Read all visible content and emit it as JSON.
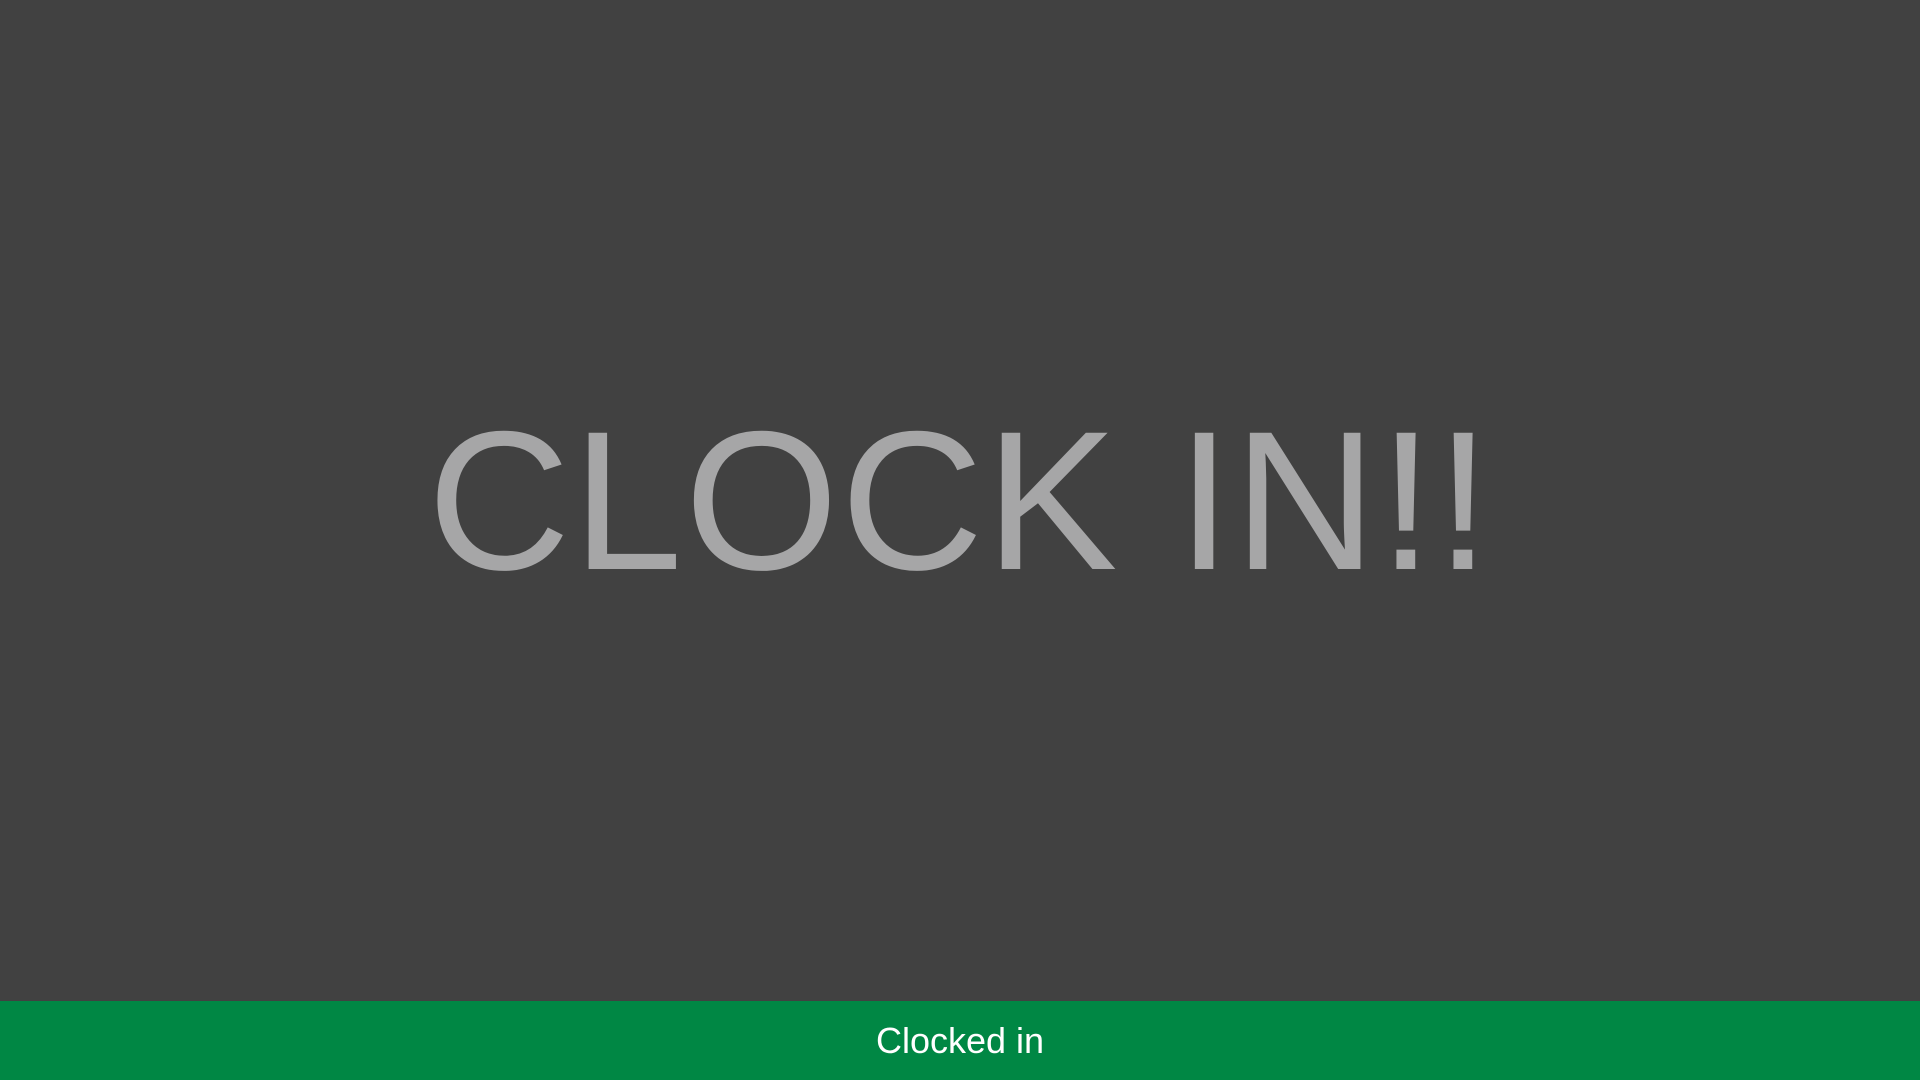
{
  "main": {
    "action_label": "CLOCK IN!!"
  },
  "status_bar": {
    "text": "Clocked in"
  },
  "colors": {
    "background": "#414141",
    "action_text": "#a6a6a7",
    "status_background": "#008744",
    "status_text": "#ffffff"
  }
}
